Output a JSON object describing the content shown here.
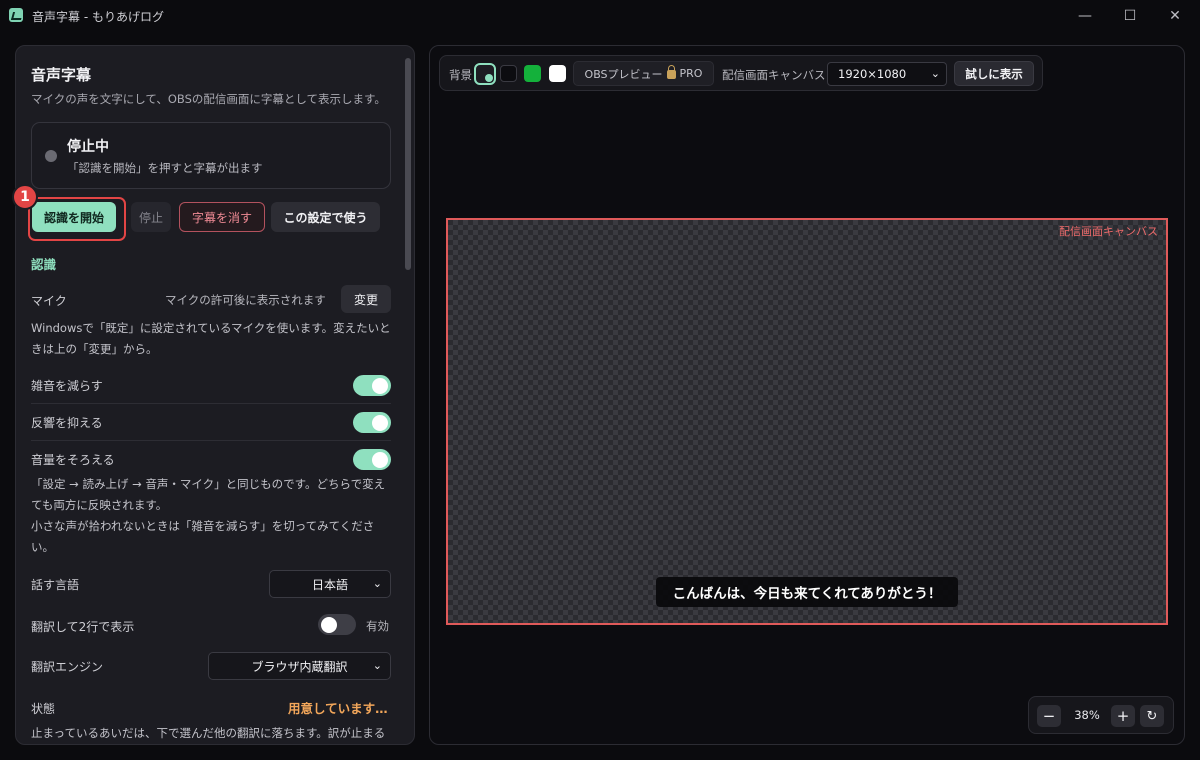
{
  "window": {
    "title": "音声字幕 - もりあげログ"
  },
  "panel": {
    "title": "音声字幕",
    "subtitle": "マイクの声を文字にして、OBSの配信画面に字幕として表示します。"
  },
  "status": {
    "title": "停止中",
    "description": "「認識を開始」を押すと字幕が出ます"
  },
  "actions": {
    "badge": "1",
    "start": "認識を開始",
    "stop": "停止",
    "clear": "字幕を消す",
    "use": "この設定で使う"
  },
  "recognition": {
    "heading": "認識",
    "mic_label": "マイク",
    "mic_hint": "マイクの許可後に表示されます",
    "mic_change": "変更",
    "mic_note_1": "Windowsで「既定」に設定されているマイクを使います。変えたいと",
    "mic_note_2": "きは上の「変更」から。",
    "noise_label": "雑音を減らす",
    "noise_on": true,
    "echo_label": "反響を抑える",
    "echo_on": true,
    "volume_label": "音量をそろえる",
    "volume_on": true,
    "volume_note_1": "「設定 → 読み上げ → 音声・マイク」と同じものです。どちらで変え",
    "volume_note_2": "ても両方に反映されます。",
    "volume_note_3": "小さな声が拾われないときは「雑音を減らす」を切ってみてくださ",
    "volume_note_4": "い。",
    "language_label": "話す言語",
    "language_value": "日本語",
    "translate_label": "翻訳して2行で表示",
    "translate_on": false,
    "translate_state": "有効",
    "engine_label": "翻訳エンジン",
    "engine_value": "ブラウザ内蔵翻訳",
    "state_label": "状態",
    "state_value": "用意しています…",
    "state_note": "止まっているあいだは、下で選んだ他の翻訳に落ちます。訳が止まる"
  },
  "toolbar": {
    "bg_label": "背景",
    "obs_preview": "OBSプレビュー",
    "pro": "PRO",
    "canvas_label": "配信画面キャンバス",
    "resolution": "1920×1080",
    "trial": "試しに表示"
  },
  "canvas": {
    "label": "配信画面キャンバス",
    "subtitle": "こんばんは、今日も来てくれてありがとう！"
  },
  "zoom": {
    "minus": "−",
    "value": "38%",
    "plus": "+",
    "reset": "↻"
  },
  "colors": {
    "accent": "#8fe0bf",
    "danger": "#e24545",
    "warning": "#f2a65a"
  }
}
